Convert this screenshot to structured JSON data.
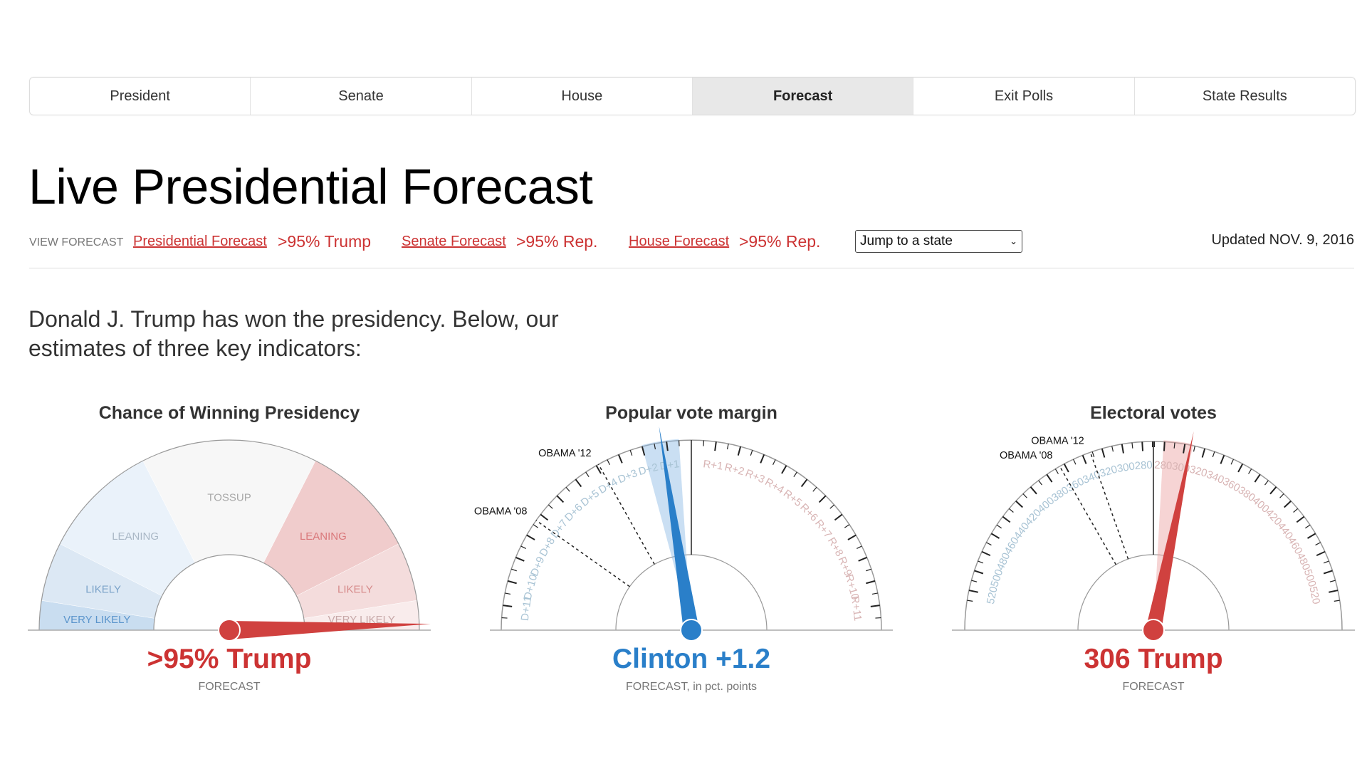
{
  "tabs": [
    {
      "label": "President",
      "active": false
    },
    {
      "label": "Senate",
      "active": false
    },
    {
      "label": "House",
      "active": false
    },
    {
      "label": "Forecast",
      "active": true
    },
    {
      "label": "Exit Polls",
      "active": false
    },
    {
      "label": "State Results",
      "active": false
    }
  ],
  "page_title": "Live Presidential Forecast",
  "view_forecast": {
    "label": "VIEW FORECAST",
    "links": [
      {
        "text": "Presidential Forecast",
        "value": ">95% Trump"
      },
      {
        "text": "Senate Forecast",
        "value": ">95% Rep."
      },
      {
        "text": "House Forecast",
        "value": ">95% Rep."
      }
    ],
    "state_select": {
      "selected": "Jump to a state"
    },
    "updated": "Updated NOV. 9, 2016"
  },
  "intro": "Donald J. Trump has won the presidency. Below, our estimates of three key indicators:",
  "colors": {
    "rep": "#d0413f",
    "dem": "#2a7fc9",
    "rep_text": "#cc3333",
    "dem_text": "#2a7fc9"
  },
  "chart_data": [
    {
      "type": "gauge",
      "title": "Chance of Winning Presidency",
      "value_label": ">95% Trump",
      "sub_label": "FORECAST",
      "needle_value_pct_rep": 99,
      "bands": [
        {
          "label": "VERY LIKELY",
          "side": "dem",
          "from": 0,
          "to": 5
        },
        {
          "label": "LIKELY",
          "side": "dem",
          "from": 5,
          "to": 15
        },
        {
          "label": "LEANING",
          "side": "dem",
          "from": 15,
          "to": 35
        },
        {
          "label": "TOSSUP",
          "side": "neutral",
          "from": 35,
          "to": 65
        },
        {
          "label": "LEANING",
          "side": "rep",
          "from": 65,
          "to": 85
        },
        {
          "label": "LIKELY",
          "side": "rep",
          "from": 85,
          "to": 95
        },
        {
          "label": "VERY LIKELY",
          "side": "rep",
          "from": 95,
          "to": 100
        }
      ]
    },
    {
      "type": "gauge",
      "title": "Popular vote margin",
      "value_label": "Clinton +1.2",
      "sub_label_bold": "FORECAST",
      "sub_label_rest": ", in pct. points",
      "needle_value": -1.2,
      "uncertainty_range": [
        -2.0,
        -0.5
      ],
      "range": [
        -12,
        12
      ],
      "tick_labels_dem": [
        "D+1",
        "D+2",
        "D+3",
        "D+4",
        "D+5",
        "D+6",
        "D+7",
        "D+8",
        "D+9",
        "D+10",
        "D+11"
      ],
      "tick_labels_rep": [
        "R+1",
        "R+2",
        "R+3",
        "R+4",
        "R+5",
        "R+6",
        "R+7",
        "R+8",
        "R+9",
        "R+10",
        "R+11"
      ],
      "reference_lines": [
        {
          "label": "OBAMA '12",
          "value": -3.9
        },
        {
          "label": "OBAMA '08",
          "value": -7.3
        }
      ]
    },
    {
      "type": "gauge",
      "title": "Electoral votes",
      "value_label": "306 Trump",
      "sub_label": "FORECAST",
      "needle_value_rep_ev": 306,
      "uncertainty_range_rep_ev": [
        279,
        308
      ],
      "range": [
        0,
        538
      ],
      "tick_labels_dem": [
        "280",
        "300",
        "320",
        "340",
        "360",
        "380",
        "400",
        "420",
        "440",
        "460",
        "480",
        "500",
        "520"
      ],
      "tick_labels_rep": [
        "280",
        "300",
        "320",
        "340",
        "360",
        "380",
        "400",
        "420",
        "440",
        "460",
        "480",
        "500",
        "520"
      ],
      "reference_lines": [
        {
          "label": "OBAMA '12",
          "dem_ev": 332
        },
        {
          "label": "OBAMA '08",
          "dem_ev": 365
        }
      ]
    }
  ]
}
